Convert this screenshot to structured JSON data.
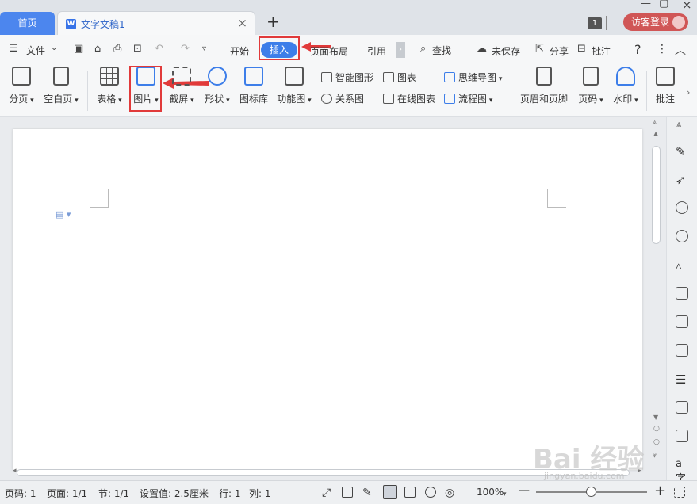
{
  "tabs": {
    "home": "首页",
    "doc": "文字文稿1",
    "close": "×",
    "new": "+"
  },
  "window": {
    "count": "1",
    "login": "访客登录",
    "min": "—",
    "max": "▢",
    "close": "×"
  },
  "menu": {
    "file": "文件",
    "items": [
      "开始",
      "插入",
      "页面布局",
      "引用"
    ],
    "find": "查找",
    "unsaved": "未保存",
    "share": "分享",
    "annotate": "批注",
    "help": "?",
    "more": "⋮"
  },
  "ribbon": {
    "page_break": "分页",
    "blank_page": "空白页",
    "table": "表格",
    "picture": "图片",
    "screenshot": "截屏",
    "shape": "形状",
    "icon_lib": "图标库",
    "func_diagram": "功能图",
    "smart_art": "智能图形",
    "chart": "图表",
    "mind_map": "思维导图",
    "relation": "关系图",
    "online_chart": "在线图表",
    "flow_chart": "流程图",
    "header_footer": "页眉和页脚",
    "page_number": "页码",
    "watermark": "水印",
    "comment": "批注"
  },
  "status": {
    "page_code": "页码: 1",
    "page": "页面: 1/1",
    "section": "节: 1/1",
    "setting": "设置值: 2.5厘米",
    "row": "行: 1",
    "col": "列: 1",
    "zoom": "100%",
    "zoom_minus": "—",
    "zoom_plus": "+"
  },
  "watermark_text": {
    "main": "Bai 经验",
    "sub": "jingyan.baidu.com"
  },
  "colors": {
    "accent": "#3d7ee9",
    "highlight": "#e13a3a",
    "login": "#d05656"
  }
}
